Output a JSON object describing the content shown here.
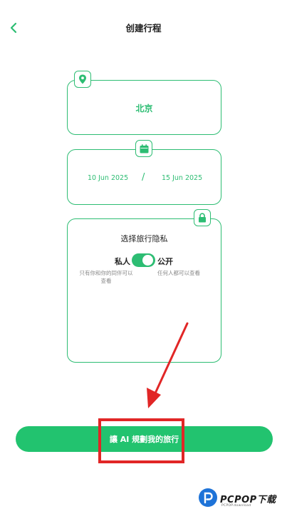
{
  "header": {
    "title": "创建行程",
    "back_icon": "chevron-left-icon"
  },
  "location": {
    "icon": "map-pin-icon",
    "city": "北京"
  },
  "dates": {
    "icon": "calendar-icon",
    "start": "10 Jun 2025",
    "separator": "/",
    "end": "15 Jun 2025"
  },
  "privacy": {
    "icon": "lock-icon",
    "title": "选择旅行隐私",
    "private_label": "私人",
    "public_label": "公开",
    "toggle_on": true,
    "private_desc": "只有你和你的同伴可以查看",
    "public_desc": "任何人都可以查看"
  },
  "cta": {
    "label": "讓 AI 規劃我的旅行"
  },
  "watermark": {
    "brand": "PCPOP下载",
    "sub": "PCPOP.download"
  },
  "colors": {
    "accent": "#2dbd73",
    "button": "#22c36f",
    "annotation": "#e12626"
  }
}
